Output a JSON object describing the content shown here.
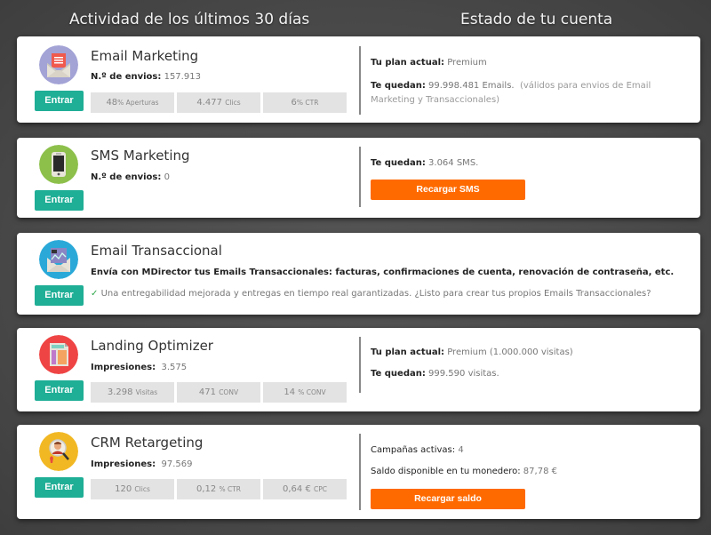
{
  "headers": {
    "activity": "Actividad de los últimos 30 días",
    "account": "Estado de tu cuenta"
  },
  "colors": {
    "enter_button": "#1fae96",
    "recharge_button": "#ff6a00",
    "stat_bg": "#e3e3e3"
  },
  "cards": {
    "email_marketing": {
      "icon": "envelope-icon",
      "title": "Email Marketing",
      "enter": "Entrar",
      "metric_label": "N.º de envios:",
      "metric_value": "157.913",
      "stats": [
        {
          "value": "48",
          "unit": "% Aperturas"
        },
        {
          "value": "4.477",
          "unit": "Clics"
        },
        {
          "value": "6",
          "unit": "% CTR"
        }
      ],
      "plan_label": "Tu plan actual:",
      "plan_value": "Premium",
      "remaining_label": "Te quedan:",
      "remaining_value": "99.998.481 Emails.",
      "remaining_note": "(válidos para envios de Email Marketing y Transaccionales)"
    },
    "sms_marketing": {
      "icon": "smartphone-icon",
      "title": "SMS Marketing",
      "enter": "Entrar",
      "metric_label": "N.º de envios:",
      "metric_value": "0",
      "remaining_label": "Te quedan:",
      "remaining_value": "3.064 SMS.",
      "recharge": "Recargar SMS"
    },
    "email_transactional": {
      "icon": "transactional-envelope-icon",
      "title": "Email Transaccional",
      "enter": "Entrar",
      "description": "Envía con MDirector tus Emails Transaccionales: facturas, confirmaciones de cuenta, renovación de contraseña, etc.",
      "check": "✓",
      "benefit": "Una entregabilidad mejorada y entregas en tiempo real garantizadas. ¿Listo para crear tus propios Emails Transaccionales?"
    },
    "landing_optimizer": {
      "icon": "landing-page-icon",
      "title": "Landing Optimizer",
      "enter": "Entrar",
      "metric_label": "Impresiones:",
      "metric_value": "3.575",
      "stats": [
        {
          "value": "3.298",
          "unit": "Visitas"
        },
        {
          "value": "471",
          "unit": "CONV"
        },
        {
          "value": "14",
          "unit": "% CONV"
        }
      ],
      "plan_label": "Tu plan actual:",
      "plan_value": "Premium (1.000.000 visitas)",
      "remaining_label": "Te quedan:",
      "remaining_value": "999.590 visitas."
    },
    "crm_retargeting": {
      "icon": "user-search-icon",
      "title": "CRM Retargeting",
      "enter": "Entrar",
      "metric_label": "Impresiones:",
      "metric_value": "97.569",
      "stats": [
        {
          "value": "120",
          "unit": "Clics"
        },
        {
          "value": "0,12",
          "unit": "% CTR"
        },
        {
          "value": "0,64 €",
          "unit": "CPC"
        }
      ],
      "campaigns_label": "Campañas activas:",
      "campaigns_value": "4",
      "balance_label": "Saldo disponible en tu monedero:",
      "balance_value": "87,78 €",
      "recharge": "Recargar saldo"
    }
  }
}
